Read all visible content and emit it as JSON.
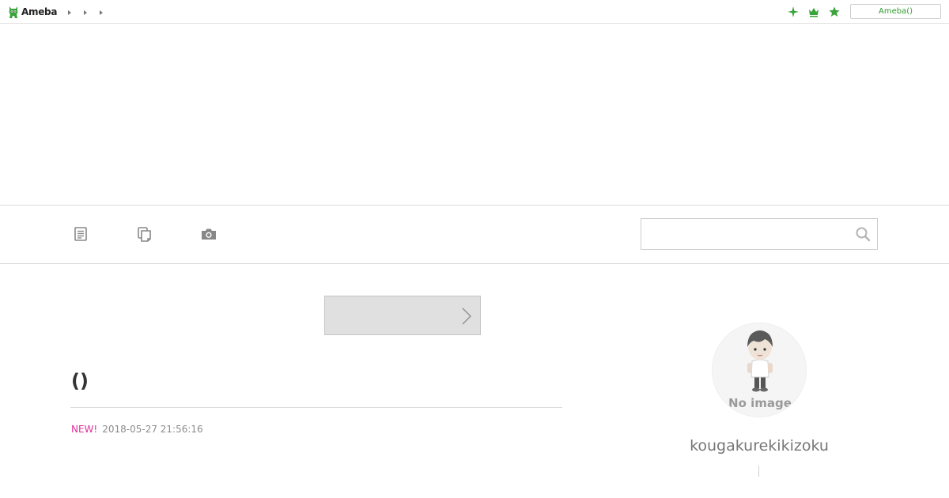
{
  "header": {
    "logo_text": "Ameba",
    "breadcrumbs": [
      "",
      "",
      ""
    ],
    "icons": [
      "sparkle-icon",
      "crown-icon",
      "star-icon"
    ],
    "account_button_label": "Ameba()"
  },
  "nav": {
    "icons": [
      "entry-list-icon",
      "pages-icon",
      "camera-icon"
    ],
    "search": {
      "value": "",
      "placeholder": ""
    }
  },
  "main": {
    "more_button_label": "",
    "entry": {
      "title": "()",
      "new_label": "NEW!",
      "date": "2018-05-27 21:56:16"
    }
  },
  "sidebar": {
    "avatar_label": "No image",
    "profile_name": "kougakurekikizoku"
  },
  "colors": {
    "brand_green": "#2f9a2f",
    "new_badge": "#e0309a",
    "muted_text": "#8c8c8c"
  }
}
